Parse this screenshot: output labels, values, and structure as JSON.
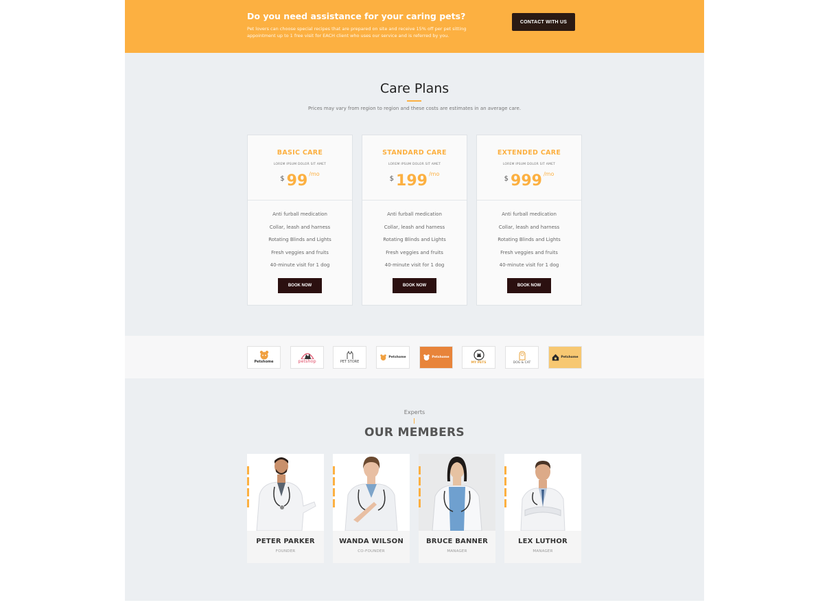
{
  "banner": {
    "title": "Do you need assistance for your caring pets?",
    "text": "Pet lovers can choose special recipes that are prepared on site and receive 15% off per pet sitting appointment up to 1 free visit for EACH client who uses our service and is referred by you.",
    "button": "CONTACT WITH US"
  },
  "plans": {
    "title": "Care Plans",
    "subtitle": "Prices may vary from region to region and these costs are estimates in an average care.",
    "items": [
      {
        "name": "BASIC CARE",
        "sub": "LOREM IPSUM DOLOR SIT AMET",
        "currency": "$",
        "price": "99",
        "per": "/mo",
        "features": [
          "Anti furball medication",
          "Collar, leash and harness",
          "Rotating Blinds and Lights",
          "Fresh veggies and fruits",
          "40-minute visit for 1 dog"
        ],
        "button": "BOOK NOW"
      },
      {
        "name": "STANDARD CARE",
        "sub": "LOREM IPSUM DOLOR SIT AMET",
        "currency": "$",
        "price": "199",
        "per": "/mo",
        "features": [
          "Anti furball medication",
          "Collar, leash and harness",
          "Rotating Blinds and Lights",
          "Fresh veggies and fruits",
          "40-minute visit for 1 dog"
        ],
        "button": "BOOK NOW"
      },
      {
        "name": "EXTENDED CARE",
        "sub": "LOREM IPSUM DOLOR SIT AMET",
        "currency": "$",
        "price": "999",
        "per": "/mo",
        "features": [
          "Anti furball medication",
          "Collar, leash and harness",
          "Rotating Blinds and Lights",
          "Fresh veggies and fruits",
          "40-minute visit for 1 dog"
        ],
        "button": "BOOK NOW"
      }
    ]
  },
  "logos": [
    {
      "name": "Petshome",
      "icon": "pet-face-icon",
      "color": "#e8913a"
    },
    {
      "name": "petshop",
      "icon": "dog-cat-silhouette-icon",
      "color": "#e0506a"
    },
    {
      "name": "PET STORE",
      "icon": "cat-outline-icon",
      "color": "#444444"
    },
    {
      "name": "Petshome",
      "icon": "pet-face-icon",
      "color": "#e8913a"
    },
    {
      "name": "Petshome",
      "icon": "pet-face-icon",
      "color": "#ffffff"
    },
    {
      "name": "MY PETS",
      "icon": "dog-circle-icon",
      "color": "#e8a23a"
    },
    {
      "name": "DOG & CAT",
      "icon": "dog-cat-outline-icon",
      "color": "#555555"
    },
    {
      "name": "Petshome",
      "icon": "pet-house-icon",
      "color": "#2a2a2a"
    }
  ],
  "members": {
    "kicker": "Experts",
    "title": "OUR MEMBERS",
    "items": [
      {
        "name": "PETER PARKER",
        "role": "FOUNDER"
      },
      {
        "name": "WANDA WILSON",
        "role": "CO-FOUNDER"
      },
      {
        "name": "BRUCE BANNER",
        "role": "MANAGER"
      },
      {
        "name": "LEX LUTHOR",
        "role": "MANAGER"
      }
    ]
  },
  "colors": {
    "accent": "#fcb041",
    "dark_button": "#2b1010",
    "section_bg": "#eceff2"
  }
}
